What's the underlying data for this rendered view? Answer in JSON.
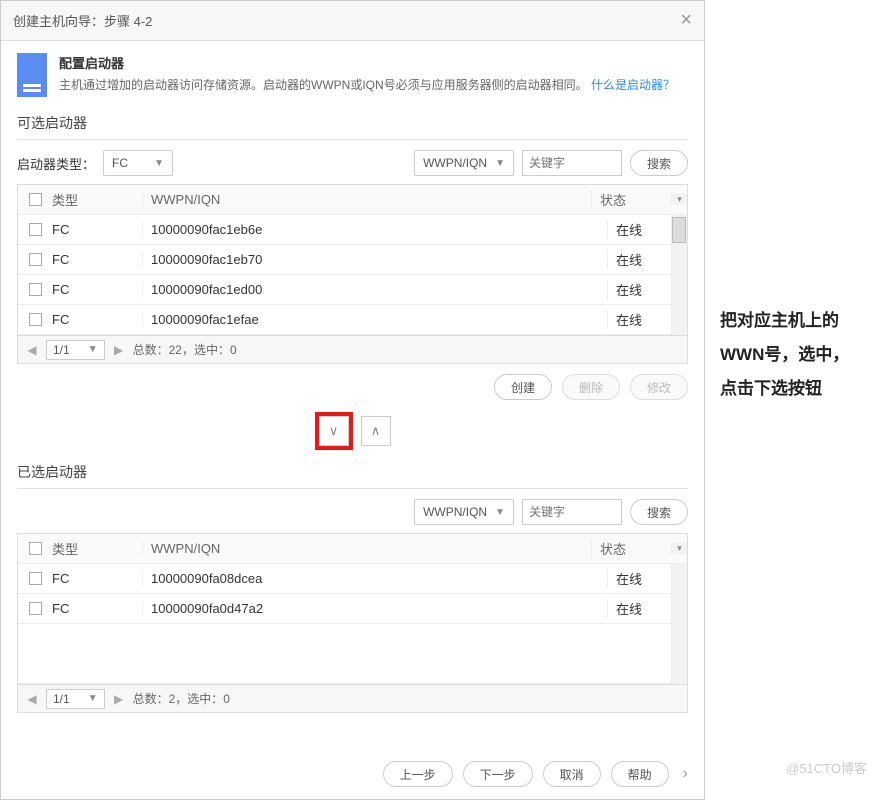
{
  "dialog": {
    "title": "创建主机向导：步骤 4-2",
    "close": "×",
    "header": {
      "title": "配置启动器",
      "desc": "主机通过增加的启动器访问存储资源。启动器的WWPN或IQN号必须与应用服务器侧的启动器相同。",
      "link": "什么是启动器？"
    }
  },
  "available": {
    "title": "可选启动器",
    "type_label": "启动器类型：",
    "type_value": "FC",
    "search_field": "WWPN/IQN",
    "search_placeholder": "关键字",
    "search_btn": "搜索",
    "columns": {
      "type": "类型",
      "wwpn": "WWPN/IQN",
      "status": "状态"
    },
    "rows": [
      {
        "type": "FC",
        "wwpn": "10000090fac1eb6e",
        "status": "在线"
      },
      {
        "type": "FC",
        "wwpn": "10000090fac1eb70",
        "status": "在线"
      },
      {
        "type": "FC",
        "wwpn": "10000090fac1ed00",
        "status": "在线"
      },
      {
        "type": "FC",
        "wwpn": "10000090fac1efae",
        "status": "在线"
      }
    ],
    "page": "1/1",
    "total": "总数：22，选中：0"
  },
  "actions": {
    "create": "创建",
    "delete": "删除",
    "modify": "修改"
  },
  "selected": {
    "title": "已选启动器",
    "search_field": "WWPN/IQN",
    "search_placeholder": "关键字",
    "search_btn": "搜索",
    "columns": {
      "type": "类型",
      "wwpn": "WWPN/IQN",
      "status": "状态"
    },
    "rows": [
      {
        "type": "FC",
        "wwpn": "10000090fa08dcea",
        "status": "在线"
      },
      {
        "type": "FC",
        "wwpn": "10000090fa0d47a2",
        "status": "在线"
      }
    ],
    "page": "1/1",
    "total": "总数：2，选中：0"
  },
  "footer": {
    "prev": "上一步",
    "next": "下一步",
    "cancel": "取消",
    "help": "帮助"
  },
  "annotation": {
    "l1": "把对应主机上的",
    "l2": "WWN号，选中，",
    "l3": "点击下选按钮"
  },
  "watermark": "@51CTO博客"
}
